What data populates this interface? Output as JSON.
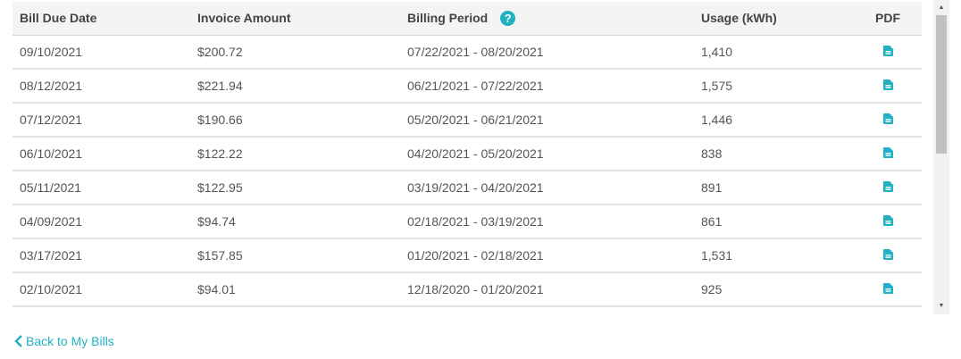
{
  "table": {
    "headers": {
      "due_date": "Bill Due Date",
      "amount": "Invoice Amount",
      "period": "Billing Period",
      "usage": "Usage (kWh)",
      "pdf": "PDF"
    },
    "help_glyph": "?",
    "rows": [
      {
        "due_date": "09/10/2021",
        "amount": "$200.72",
        "period": "07/22/2021 - 08/20/2021",
        "usage": "1,410"
      },
      {
        "due_date": "08/12/2021",
        "amount": "$221.94",
        "period": "06/21/2021 - 07/22/2021",
        "usage": "1,575"
      },
      {
        "due_date": "07/12/2021",
        "amount": "$190.66",
        "period": "05/20/2021 - 06/21/2021",
        "usage": "1,446"
      },
      {
        "due_date": "06/10/2021",
        "amount": "$122.22",
        "period": "04/20/2021 - 05/20/2021",
        "usage": "838"
      },
      {
        "due_date": "05/11/2021",
        "amount": "$122.95",
        "period": "03/19/2021 - 04/20/2021",
        "usage": "891"
      },
      {
        "due_date": "04/09/2021",
        "amount": "$94.74",
        "period": "02/18/2021 - 03/19/2021",
        "usage": "861"
      },
      {
        "due_date": "03/17/2021",
        "amount": "$157.85",
        "period": "01/20/2021 - 02/18/2021",
        "usage": "1,531"
      },
      {
        "due_date": "02/10/2021",
        "amount": "$94.01",
        "period": "12/18/2020 - 01/20/2021",
        "usage": "925"
      }
    ]
  },
  "back_link": {
    "label": "Back to My Bills"
  },
  "colors": {
    "accent": "#1fb3c2",
    "header_bg": "#f4f4f4",
    "text": "#555555"
  },
  "icons": {
    "pdf": "pdf-document-icon",
    "help": "question-circle-icon",
    "back": "chevron-left-icon"
  }
}
